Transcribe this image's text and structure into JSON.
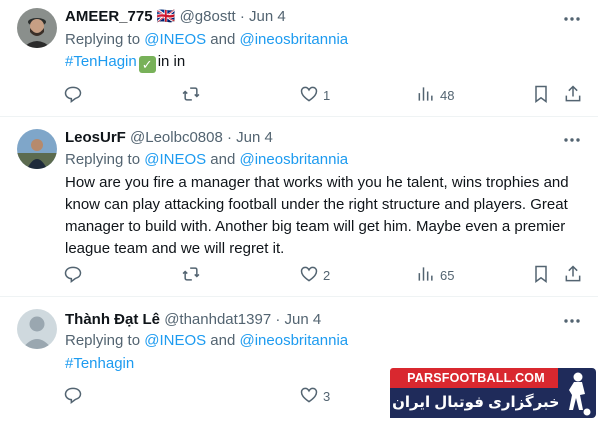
{
  "tweets": [
    {
      "name": "AMEER_775",
      "flag": "🇬🇧",
      "handle": "@g8ostt",
      "separator": "·",
      "date": "Jun 4",
      "replying_prefix": "Replying to",
      "mention1": "@INEOS",
      "and": "and",
      "mention2": "@ineosbritannia",
      "hashtag": "#TenHagin",
      "check": "✓",
      "suffix": "in in",
      "replies": "",
      "retweets": "",
      "likes": "1",
      "views": "48"
    },
    {
      "name": "LeosUrF",
      "handle": "@Leolbc0808",
      "separator": "·",
      "date": "Jun 4",
      "replying_prefix": "Replying to",
      "mention1": "@INEOS",
      "and": "and",
      "mention2": "@ineosbritannia",
      "text": "How are you fire a manager that works with you he talent, wins trophies and know can play attacking football under the right structure and players. Great manager to build with. Another big team will get him. Maybe even a premier league team and we will regret it.",
      "replies": "",
      "retweets": "",
      "likes": "2",
      "views": "65"
    },
    {
      "name": "Thành Đạt Lê",
      "handle": "@thanhdat1397",
      "separator": "·",
      "date": "Jun 4",
      "replying_prefix": "Replying to",
      "mention1": "@INEOS",
      "and": "and",
      "mention2": "@ineosbritannia",
      "hashtag": "#Tenhagin",
      "replies": "",
      "likes": "3"
    }
  ],
  "watermark": {
    "site": "PARSFOOTBALL.COM",
    "tagline": "خبرگزاری فوتبال ایران"
  },
  "icons": {
    "more": "more-dots-icon",
    "reply": "reply-bubble-icon",
    "retweet": "retweet-icon",
    "like": "heart-icon",
    "views": "views-bar-chart-icon",
    "bookmark": "bookmark-icon",
    "share": "share-upload-icon"
  },
  "colors": {
    "link": "#1d9bf0",
    "muted": "#536471",
    "text": "#0f1419",
    "divider": "#eff3f4",
    "watermark_red": "#d9282f",
    "watermark_navy": "#1f2b5a"
  }
}
